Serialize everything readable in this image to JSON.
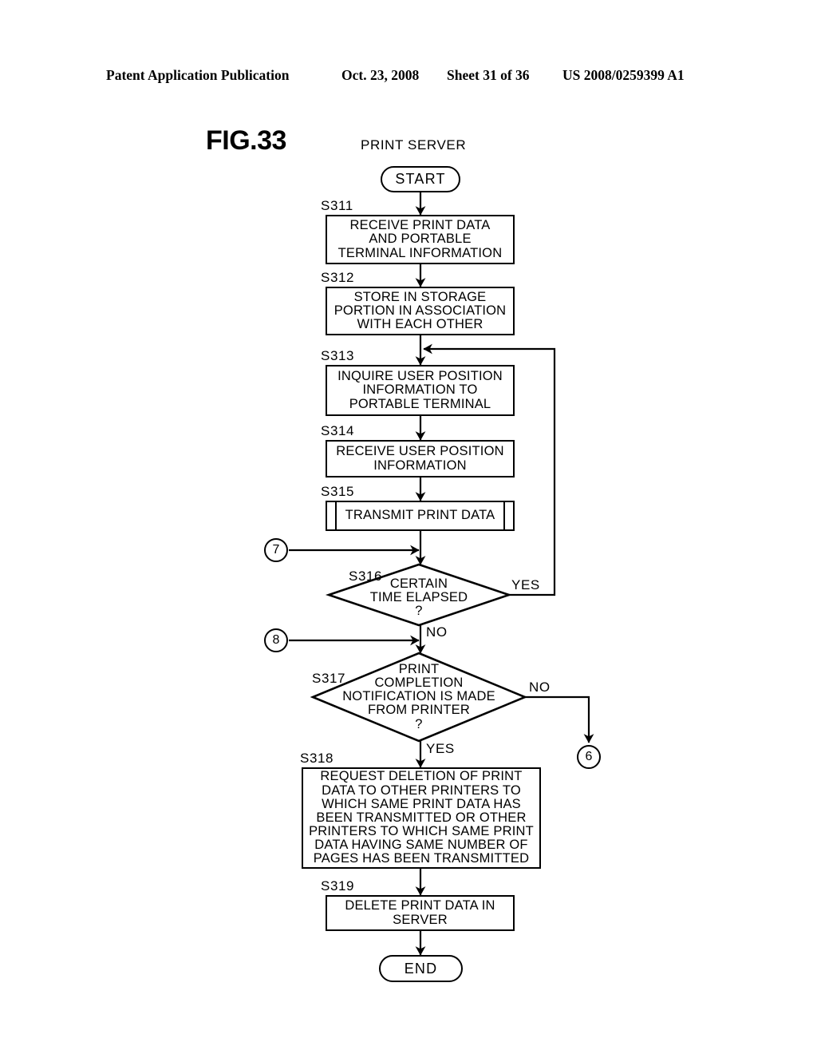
{
  "header": {
    "publication": "Patent Application Publication",
    "date": "Oct. 23, 2008",
    "sheet": "Sheet 31 of 36",
    "patent_number": "US 2008/0259399 A1"
  },
  "figure": {
    "label": "FIG.33",
    "lane_title": "PRINT SERVER"
  },
  "flow": {
    "start": "START",
    "end": "END",
    "steps": [
      {
        "id": "S311",
        "kind": "process",
        "lines": [
          "RECEIVE PRINT DATA",
          "AND PORTABLE",
          "TERMINAL INFORMATION"
        ]
      },
      {
        "id": "S312",
        "kind": "process",
        "lines": [
          "STORE IN STORAGE",
          "PORTION IN ASSOCIATION",
          "WITH EACH OTHER"
        ]
      },
      {
        "id": "S313",
        "kind": "process",
        "lines": [
          "INQUIRE USER POSITION",
          "INFORMATION TO",
          "PORTABLE TERMINAL"
        ]
      },
      {
        "id": "S314",
        "kind": "process",
        "lines": [
          "RECEIVE USER POSITION",
          "INFORMATION"
        ]
      },
      {
        "id": "S315",
        "kind": "predefined-process",
        "lines": [
          "TRANSMIT PRINT DATA"
        ]
      },
      {
        "id": "S316",
        "kind": "decision",
        "lines": [
          "CERTAIN",
          "TIME ELAPSED",
          "?"
        ],
        "yes_label": "YES",
        "no_label": "NO"
      },
      {
        "id": "S317",
        "kind": "decision",
        "lines": [
          "PRINT",
          "COMPLETION",
          "NOTIFICATION IS MADE",
          "FROM PRINTER",
          "?"
        ],
        "yes_label": "YES",
        "no_label": "NO"
      },
      {
        "id": "S318",
        "kind": "process",
        "lines": [
          "REQUEST DELETION OF PRINT",
          "DATA TO OTHER PRINTERS TO",
          "WHICH SAME PRINT DATA HAS",
          "BEEN TRANSMITTED OR OTHER",
          "PRINTERS TO WHICH SAME PRINT",
          "DATA HAVING SAME NUMBER OF",
          "PAGES HAS BEEN TRANSMITTED"
        ]
      },
      {
        "id": "S319",
        "kind": "process",
        "lines": [
          "DELETE PRINT DATA IN",
          "SERVER"
        ]
      }
    ],
    "connectors": [
      {
        "label": "7"
      },
      {
        "label": "8"
      },
      {
        "label": "6"
      }
    ]
  },
  "colors": {
    "ink": "#000000",
    "paper": "#ffffff"
  }
}
